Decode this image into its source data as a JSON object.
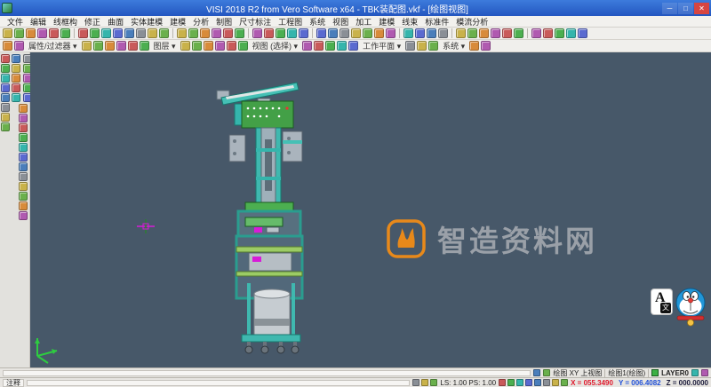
{
  "window": {
    "title": "VISI 2018 R2 from Vero Software x64 - TBK装配图.vkf - [绘图视图]",
    "controls": {
      "minimize": "─",
      "maximize": "□",
      "close": "✕"
    }
  },
  "menubar": {
    "items": [
      "文件",
      "编辑",
      "线框构",
      "修正",
      "曲面",
      "实体建模",
      "建模",
      "分析",
      "制图",
      "尺寸标注",
      "工程图",
      "系统",
      "视图",
      "加工",
      "建模",
      "线束",
      "标准件",
      "模流分析"
    ]
  },
  "toolbars": {
    "row1_groups": [
      6,
      8,
      6,
      5,
      7,
      4,
      6,
      5
    ],
    "row2_segments": [
      {
        "icons": 2
      },
      {
        "label": "属性/过滤器"
      },
      {
        "icons": 6
      },
      {
        "label": "图层"
      },
      {
        "icons": 6
      },
      {
        "label": "视图 (选择)"
      },
      {
        "icons": 5
      },
      {
        "label": "工作平面"
      },
      {
        "icons": 3
      },
      {
        "label": "系统"
      },
      {
        "icons": 2
      }
    ],
    "left_strip_icons": 8,
    "left_grid_icons": 10,
    "left_column_icons": 12,
    "palette": [
      "#4a7ebb",
      "#4caf50",
      "#d88b3a",
      "#8a8f96",
      "#35b5ac",
      "#b05ab0",
      "#c9b24a",
      "#5a6ad0",
      "#c95a5a",
      "#6ab04c"
    ]
  },
  "viewport": {
    "background": "#475869"
  },
  "watermark": {
    "text": "智造资料网",
    "logo_color": "#e8891a",
    "text_color": "#9aa0a8"
  },
  "widgets": {
    "translate_label": "A",
    "translate_sub": "文"
  },
  "status_top": {
    "view_info": "绘图 XY 上视图",
    "doc_info": "绘图1(绘图)",
    "layer": "LAYER0"
  },
  "status_bottom": {
    "note": "注释",
    "ls_ps": "LS: 1.00  PS: 1.00",
    "coord_x": "X = 055.3490",
    "coord_y": "Y = 006.4082",
    "coord_z": "Z = 000.0000",
    "coord_x_color": "#e0192c",
    "coord_y_color": "#1f4fd8",
    "coord_z_color": "#1a1a3a",
    "cluster_icons": 8,
    "pre_icons": 3
  }
}
